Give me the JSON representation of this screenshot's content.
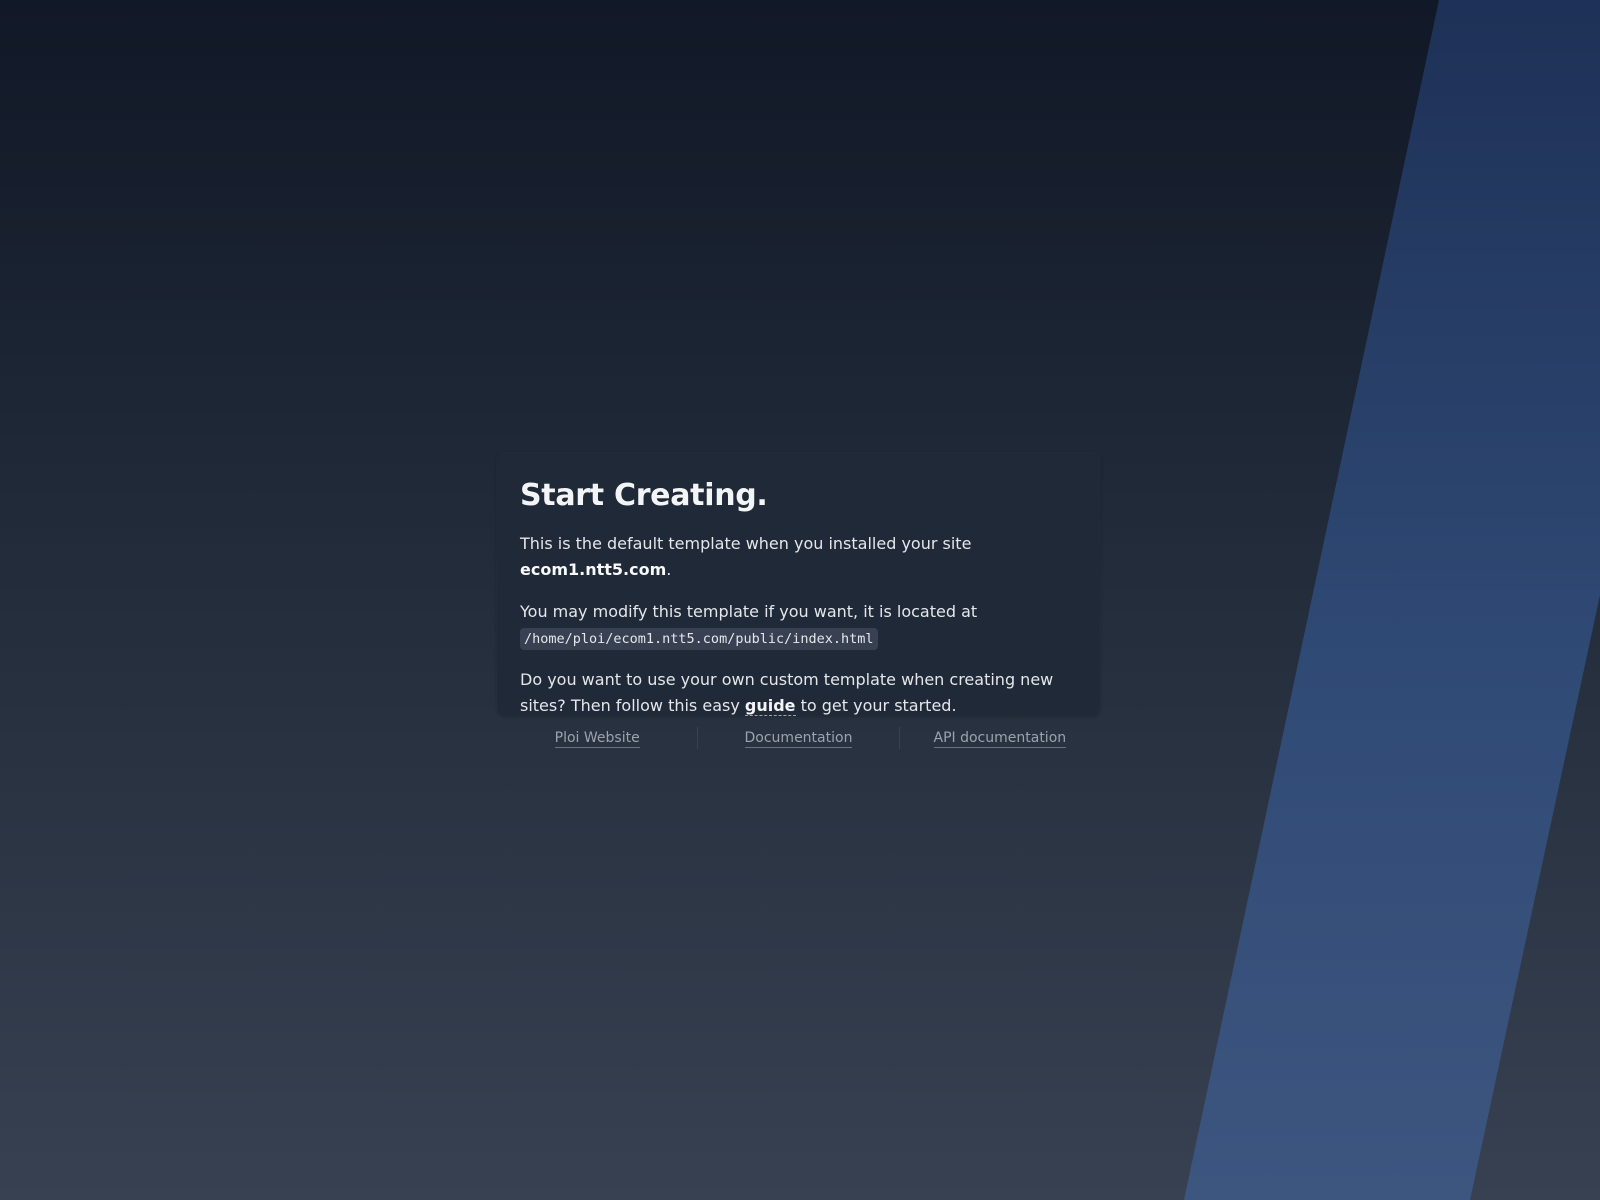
{
  "card": {
    "title": "Start Creating.",
    "intro_prefix": "This is the default template when you installed your site ",
    "site_domain": "ecom1.ntt5.com",
    "intro_suffix": ".",
    "modify_text": "You may modify this template if you want, it is located at",
    "template_path": "/home/ploi/ecom1.ntt5.com/public/index.html",
    "custom_prefix": "Do you want to use your own custom template when creating new sites? Then follow this easy ",
    "guide_label": "guide",
    "custom_suffix": " to get your started."
  },
  "footer": {
    "links": [
      {
        "label": "Ploi Website"
      },
      {
        "label": "Documentation"
      },
      {
        "label": "API documentation"
      }
    ]
  },
  "colors": {
    "background_top": "#111827",
    "background_bottom": "#374151",
    "card_background": "#1f2937",
    "accent_stripe": "#2f4a75"
  }
}
